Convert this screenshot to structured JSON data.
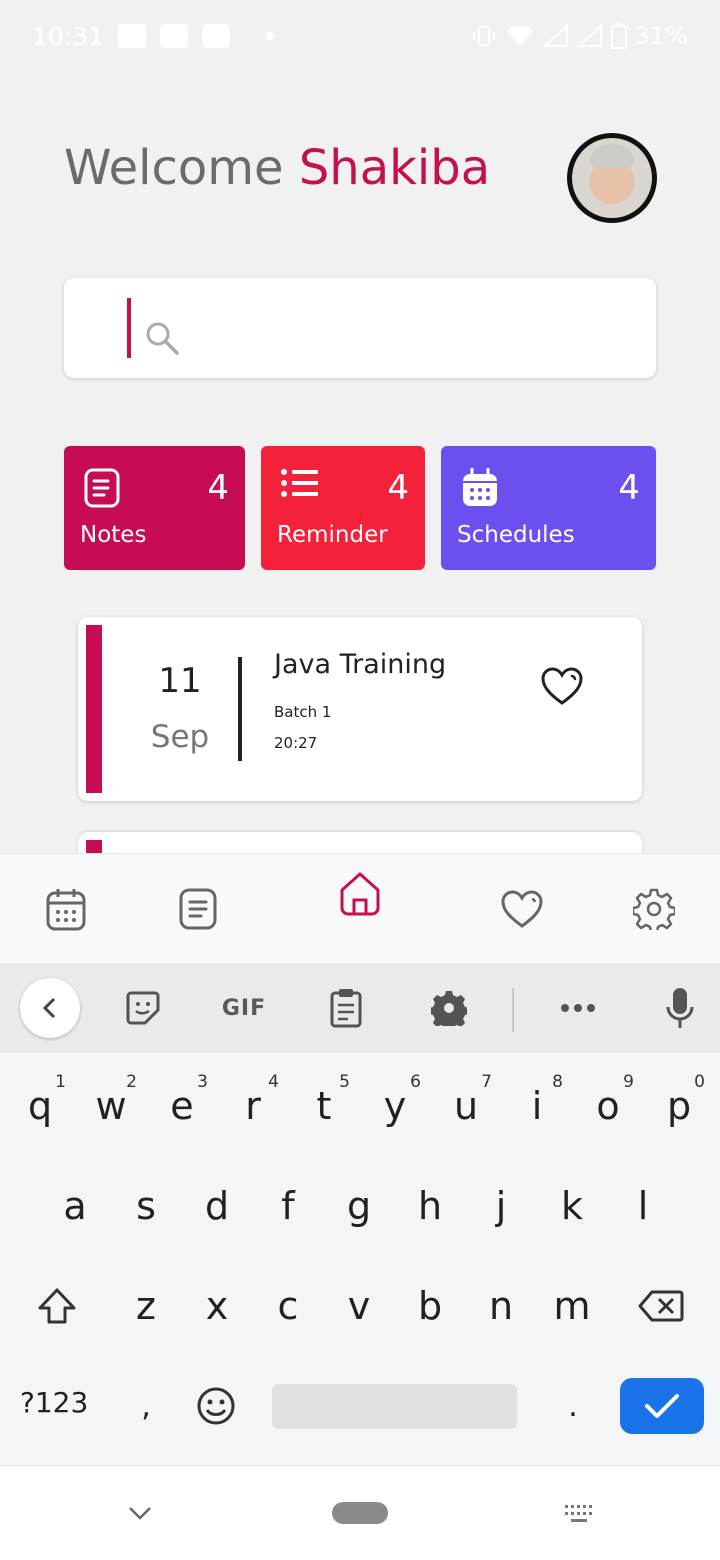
{
  "status_bar": {
    "time": "10:31",
    "battery": "31%",
    "icons": [
      "facebook-icon",
      "youtube-icon",
      "youtube-icon",
      "vibrate-icon",
      "wifi-icon",
      "signal-icon",
      "signal-icon",
      "battery-icon"
    ]
  },
  "header": {
    "welcome": "Welcome",
    "name": "Shakiba"
  },
  "search": {
    "placeholder": ""
  },
  "stats": [
    {
      "label": "Notes",
      "count": "4",
      "icon": "notes-icon",
      "color": "#c60c52"
    },
    {
      "label": "Reminder",
      "count": "4",
      "icon": "list-icon",
      "color": "#f32139"
    },
    {
      "label": "Schedules",
      "count": "4",
      "icon": "calendar-icon",
      "color": "#6c4fef"
    }
  ],
  "entries": [
    {
      "day": "11",
      "month": "Sep",
      "title": "Java Training",
      "subtitle": "Batch 1",
      "time": "20:27"
    }
  ],
  "bottom_nav": [
    "calendar-icon",
    "notes-icon",
    "home-icon",
    "heart-icon",
    "settings-icon"
  ],
  "keyboard": {
    "toolbar": {
      "gif": "GIF"
    },
    "row1": [
      "q",
      "w",
      "e",
      "r",
      "t",
      "y",
      "u",
      "i",
      "o",
      "p"
    ],
    "row1_hints": [
      "1",
      "2",
      "3",
      "4",
      "5",
      "6",
      "7",
      "8",
      "9",
      "0"
    ],
    "row2": [
      "a",
      "s",
      "d",
      "f",
      "g",
      "h",
      "j",
      "k",
      "l"
    ],
    "row3": [
      "z",
      "x",
      "c",
      "v",
      "b",
      "n",
      "m"
    ],
    "symbols_key": "?123",
    "comma": ",",
    "period": "."
  },
  "colors": {
    "accent": "#c4104f",
    "enter": "#1a73e8"
  }
}
